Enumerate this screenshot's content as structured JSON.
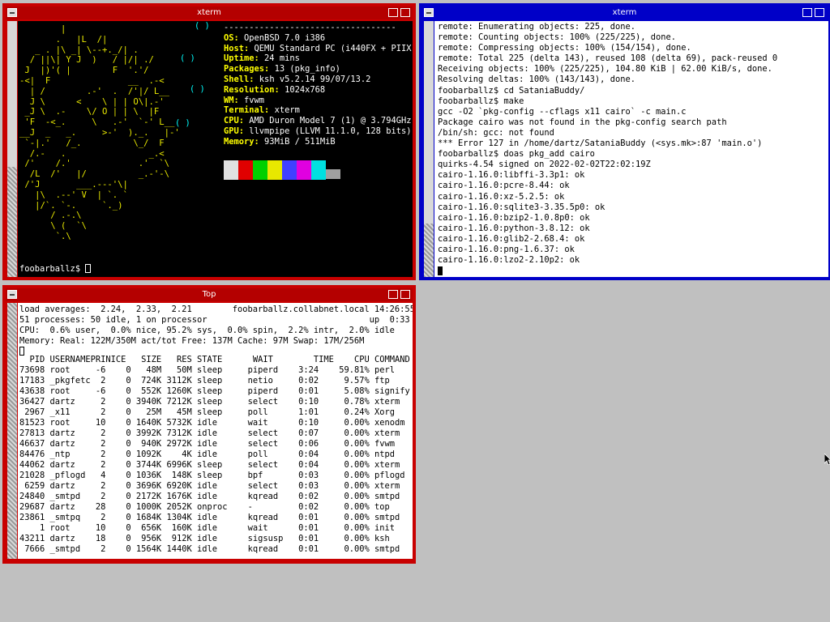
{
  "desktop": {
    "background": "#c0c0c0"
  },
  "windows": {
    "xterm_left": {
      "title": "xterm",
      "ascii_lines": [
        "        |",
        "       .   |L  /|",
        "   _ . |\\ _| \\--+._/| .",
        "  / ||\\| Y J  )   / |/| ./",
        " J  |)'( |        F  '.'/",
        "-<|  F               __  .-<",
        "  | /        .-'  .  /'|/ L__",
        "  J \\      <    \\ | | O\\|.-'",
        " _J \\  .-    \\/ O | | \\  |F",
        " 'F  -<_.     \\   .-'  `-' L__",
        "__J  _   _.     >-'  )._.   |-'",
        " `-|.'   /_.          \\_/  F",
        "  /.-   .                _.<",
        " /'    /.'             .'  `\\",
        "  /L  /'   |/          _.-'-\\",
        " /'J       ___.---'\\|",
        "   |\\  .--' V  | `. `",
        "   |/`. `-.     `._)",
        "      / .-.\\",
        "      \\ (  `\\",
        "       `.\\"
      ],
      "ascii_red": "\\|",
      "neofetch": {
        "separator": "----------------------------------",
        "rows": [
          {
            "key": "OS",
            "value": "OpenBSD 7.0 i386"
          },
          {
            "key": "Host",
            "value": "QEMU Standard PC (i440FX + PIIX"
          },
          {
            "key": "Uptime",
            "value": "24 mins"
          },
          {
            "key": "Packages",
            "value": "13 (pkg_info)"
          },
          {
            "key": "Shell",
            "value": "ksh v5.2.14 99/07/13.2"
          },
          {
            "key": "Resolution",
            "value": "1024x768"
          },
          {
            "key": "WM",
            "value": "fvwm"
          },
          {
            "key": "Terminal",
            "value": "xterm"
          },
          {
            "key": "CPU",
            "value": "AMD Duron Model 7 (1) @ 3.794GHz"
          },
          {
            "key": "GPU",
            "value": "llvmpipe (LLVM 11.1.0, 128 bits)"
          },
          {
            "key": "Memory",
            "value": "93MiB / 511MiB"
          }
        ],
        "swatch_colors": [
          "#e0e0e0",
          "#e00000",
          "#00d000",
          "#e8e800",
          "#4040ff",
          "#e000e0",
          "#00e0e0",
          "#a0a0a0"
        ],
        "sparkles": [
          "( )",
          "(  )",
          "( )",
          "(  )"
        ]
      },
      "prompt": "foobarballz$"
    },
    "xterm_right": {
      "title": "xterm",
      "lines": [
        "remote: Enumerating objects: 225, done.",
        "remote: Counting objects: 100% (225/225), done.",
        "remote: Compressing objects: 100% (154/154), done.",
        "remote: Total 225 (delta 143), reused 108 (delta 69), pack-reused 0",
        "Receiving objects: 100% (225/225), 104.80 KiB | 62.00 KiB/s, done.",
        "Resolving deltas: 100% (143/143), done.",
        "foobarballz$ cd SataniaBuddy/",
        "foobarballz$ make",
        "gcc -O2 `pkg-config --cflags x11 cairo` -c main.c",
        "Package cairo was not found in the pkg-config search path",
        "/bin/sh: gcc: not found",
        "*** Error 127 in /home/dartz/SataniaBuddy (<sys.mk>:87 'main.o')",
        "foobarballz$ doas pkg_add cairo",
        "quirks-4.54 signed on 2022-02-02T22:02:19Z",
        "cairo-1.16.0:libffi-3.3p1: ok",
        "cairo-1.16.0:pcre-8.44: ok",
        "cairo-1.16.0:xz-5.2.5: ok",
        "cairo-1.16.0:sqlite3-3.35.5p0: ok",
        "cairo-1.16.0:bzip2-1.0.8p0: ok",
        "cairo-1.16.0:python-3.8.12: ok",
        "cairo-1.16.0:glib2-2.68.4: ok",
        "cairo-1.16.0:png-1.6.37: ok",
        "cairo-1.16.0:lzo2-2.10p2: ok"
      ]
    },
    "top": {
      "title": "Top",
      "header_lines": [
        "load averages:  2.24,  2.33,  2.21        foobarballz.collabnet.local 14:26:55",
        "51 processes: 50 idle, 1 on processor                                up  0:33",
        "CPU:  0.6% user,  0.0% nice, 95.2% sys,  0.0% spin,  2.2% intr,  2.0% idle",
        "Memory: Real: 122M/350M act/tot Free: 137M Cache: 97M Swap: 17M/256M"
      ],
      "columns": [
        "  PID",
        " USERNAME",
        "PRI",
        "NICE",
        "  SIZE",
        "   RES",
        " STATE",
        "    WAIT",
        "     TIME",
        "    CPU",
        " COMMAND"
      ],
      "processes": [
        [
          "73698",
          "root",
          "-6",
          "0",
          "48M",
          "50M",
          "sleep",
          "piperd",
          "3:24",
          "59.81%",
          "perl"
        ],
        [
          "17183",
          "_pkgfetc",
          "2",
          "0",
          "724K",
          "3112K",
          "sleep",
          "netio",
          "0:02",
          "9.57%",
          "ftp"
        ],
        [
          "43638",
          "root",
          "-6",
          "0",
          "552K",
          "1260K",
          "sleep",
          "piperd",
          "0:01",
          "5.08%",
          "signify"
        ],
        [
          "36427",
          "dartz",
          "2",
          "0",
          "3940K",
          "7212K",
          "sleep",
          "select",
          "0:10",
          "0.78%",
          "xterm"
        ],
        [
          "2967",
          "_x11",
          "2",
          "0",
          "25M",
          "45M",
          "sleep",
          "poll",
          "1:01",
          "0.24%",
          "Xorg"
        ],
        [
          "81523",
          "root",
          "10",
          "0",
          "1640K",
          "5732K",
          "idle",
          "wait",
          "0:10",
          "0.00%",
          "xenodm"
        ],
        [
          "27813",
          "dartz",
          "2",
          "0",
          "3992K",
          "7312K",
          "idle",
          "select",
          "0:07",
          "0.00%",
          "xterm"
        ],
        [
          "46637",
          "dartz",
          "2",
          "0",
          "940K",
          "2972K",
          "idle",
          "select",
          "0:06",
          "0.00%",
          "fvwm"
        ],
        [
          "84476",
          "_ntp",
          "2",
          "0",
          "1092K",
          "4K",
          "idle",
          "poll",
          "0:04",
          "0.00%",
          "ntpd"
        ],
        [
          "44062",
          "dartz",
          "2",
          "0",
          "3744K",
          "6996K",
          "sleep",
          "select",
          "0:04",
          "0.00%",
          "xterm"
        ],
        [
          "21028",
          "_pflogd",
          "4",
          "0",
          "1036K",
          "148K",
          "sleep",
          "bpf",
          "0:03",
          "0.00%",
          "pflogd"
        ],
        [
          "6259",
          "dartz",
          "2",
          "0",
          "3696K",
          "6920K",
          "idle",
          "select",
          "0:03",
          "0.00%",
          "xterm"
        ],
        [
          "24840",
          "_smtpd",
          "2",
          "0",
          "2172K",
          "1676K",
          "idle",
          "kqread",
          "0:02",
          "0.00%",
          "smtpd"
        ],
        [
          "29687",
          "dartz",
          "28",
          "0",
          "1000K",
          "2052K",
          "onproc",
          "-",
          "0:02",
          "0.00%",
          "top"
        ],
        [
          "23861",
          "_smtpq",
          "2",
          "0",
          "1684K",
          "1304K",
          "idle",
          "kqread",
          "0:01",
          "0.00%",
          "smtpd"
        ],
        [
          "1",
          "root",
          "10",
          "0",
          "656K",
          "160K",
          "idle",
          "wait",
          "0:01",
          "0.00%",
          "init"
        ],
        [
          "43211",
          "dartz",
          "18",
          "0",
          "956K",
          "912K",
          "idle",
          "sigsusp",
          "0:01",
          "0.00%",
          "ksh"
        ],
        [
          "7666",
          "_smtpd",
          "2",
          "0",
          "1564K",
          "1440K",
          "idle",
          "kqread",
          "0:01",
          "0.00%",
          "smtpd"
        ]
      ]
    }
  }
}
